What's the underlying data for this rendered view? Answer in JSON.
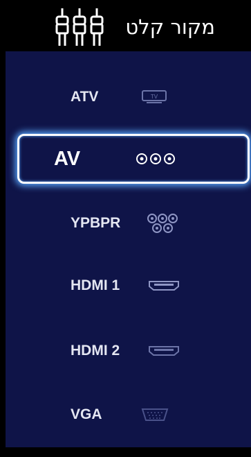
{
  "header": {
    "title": "מקור קלט",
    "icon": "rca-connector-icon"
  },
  "sources": [
    {
      "label": "ATV",
      "icon": "tv-icon",
      "selected": false
    },
    {
      "label": "AV",
      "icon": "av-rca-icon",
      "selected": true
    },
    {
      "label": "YPBPR",
      "icon": "component-icon",
      "selected": false
    },
    {
      "label": "HDMI 1",
      "icon": "hdmi-icon",
      "selected": false
    },
    {
      "label": "HDMI 2",
      "icon": "hdmi-icon",
      "selected": false
    },
    {
      "label": "VGA",
      "icon": "vga-icon",
      "selected": false
    }
  ],
  "colors": {
    "panel": "#0f1448",
    "header": "#000000",
    "focus_glow": "#5aa8ff",
    "text": "#e4e6f2"
  }
}
